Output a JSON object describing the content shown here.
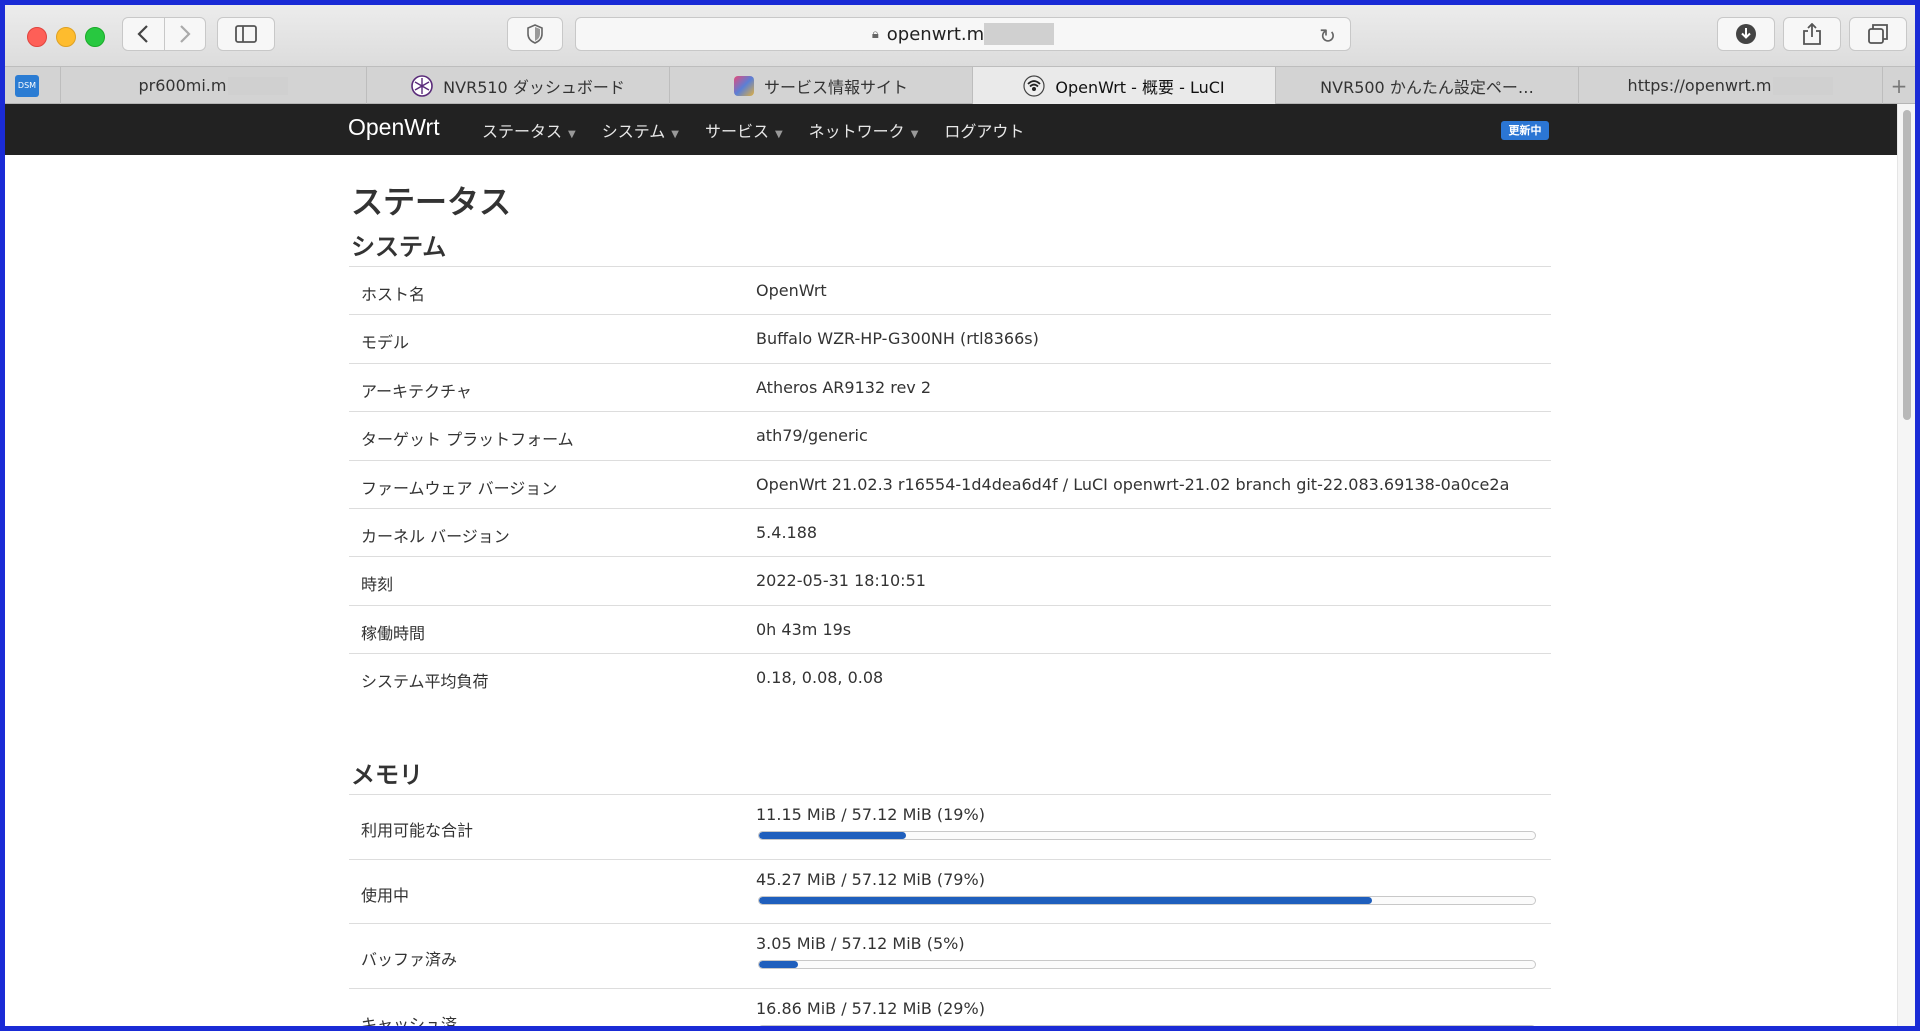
{
  "browser": {
    "url": "openwrt.m",
    "tabs": [
      {
        "label": "pr600mi.m",
        "icon": "dsm-icon",
        "active": false
      },
      {
        "label": "NVR510 ダッシュボード",
        "icon": "yamaha-icon",
        "active": false
      },
      {
        "label": "サービス情報サイト",
        "icon": "site-icon",
        "active": false
      },
      {
        "label": "OpenWrt - 概要 - LuCI",
        "icon": "openwrt-icon",
        "active": true
      },
      {
        "label": "NVR500 かんたん設定ペー…",
        "icon": "",
        "active": false
      },
      {
        "label": "https://openwrt.m",
        "icon": "",
        "active": false
      }
    ],
    "dsm_badge": "DSM"
  },
  "navbar": {
    "brand": "OpenWrt",
    "menu": [
      {
        "label": "ステータス",
        "dropdown": true
      },
      {
        "label": "システム",
        "dropdown": true
      },
      {
        "label": "サービス",
        "dropdown": true
      },
      {
        "label": "ネットワーク",
        "dropdown": true
      },
      {
        "label": "ログアウト",
        "dropdown": false
      }
    ],
    "badge": "更新中"
  },
  "page": {
    "title": "ステータス",
    "system": {
      "title": "システム",
      "rows": [
        {
          "label": "ホスト名",
          "value": "OpenWrt"
        },
        {
          "label": "モデル",
          "value": "Buffalo WZR-HP-G300NH (rtl8366s)"
        },
        {
          "label": "アーキテクチャ",
          "value": "Atheros AR9132 rev 2"
        },
        {
          "label": "ターゲット プラットフォーム",
          "value": "ath79/generic"
        },
        {
          "label": "ファームウェア バージョン",
          "value": "OpenWrt 21.02.3 r16554-1d4dea6d4f / LuCI openwrt-21.02 branch git-22.083.69138-0a0ce2a"
        },
        {
          "label": "カーネル バージョン",
          "value": "5.4.188"
        },
        {
          "label": "時刻",
          "value": "2022-05-31 18:10:51"
        },
        {
          "label": "稼働時間",
          "value": "0h 43m 19s"
        },
        {
          "label": "システム平均負荷",
          "value": "0.18, 0.08, 0.08"
        }
      ]
    },
    "memory": {
      "title": "メモリ",
      "rows": [
        {
          "label": "利用可能な合計",
          "value": "11.15 MiB / 57.12 MiB (19%)",
          "percent": 19
        },
        {
          "label": "使用中",
          "value": "45.27 MiB / 57.12 MiB (79%)",
          "percent": 79
        },
        {
          "label": "バッファ済み",
          "value": "3.05 MiB / 57.12 MiB (5%)",
          "percent": 5
        },
        {
          "label": "キャッシュ済",
          "value": "16.86 MiB / 57.12 MiB (29%)",
          "percent": 29
        }
      ]
    }
  },
  "colors": {
    "navbar_bg": "#222222",
    "progress_fill": "#1f5fbd",
    "badge_bg": "#2b76d4"
  }
}
